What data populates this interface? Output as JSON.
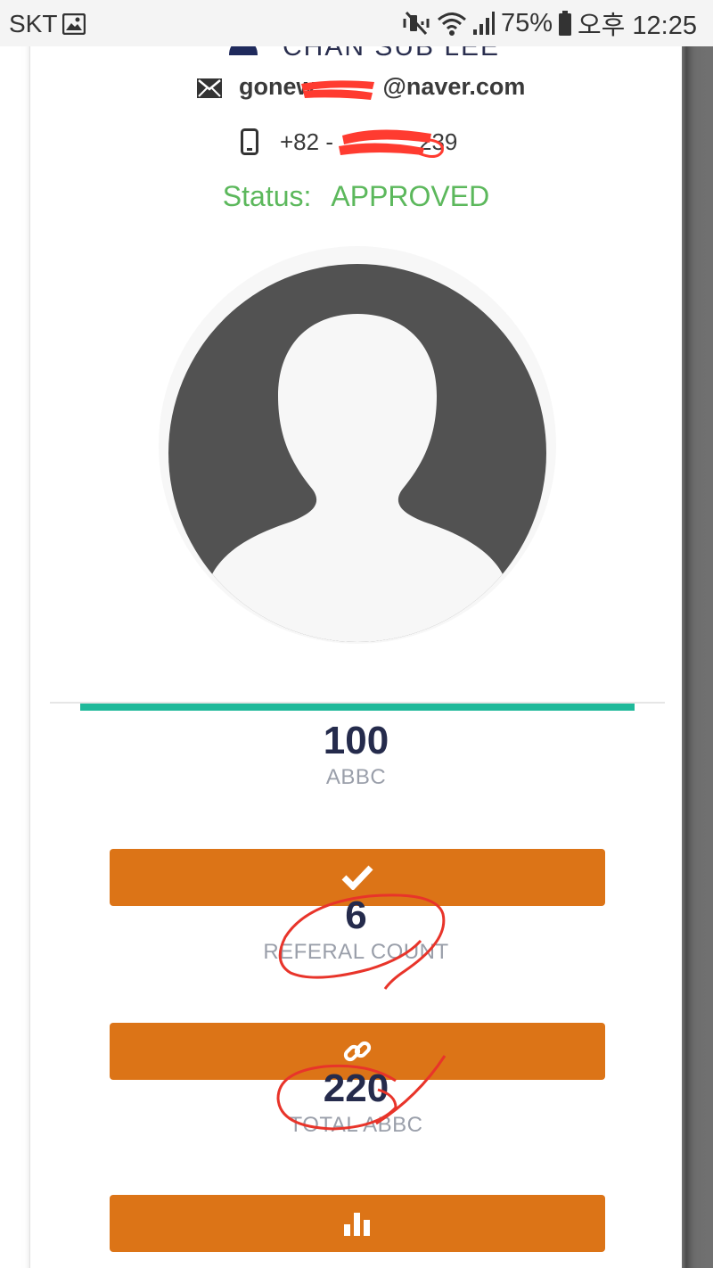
{
  "status_bar": {
    "carrier": "SKT",
    "battery": "75%",
    "time": "오후 12:25"
  },
  "profile": {
    "name": "CHAN SUB LEE",
    "email": "gonew      @naver.com",
    "email_prefix": "gonew",
    "email_suffix": "@naver.com",
    "phone_prefix": "+82 -",
    "phone_suffix": "239",
    "status_label": "Status:",
    "status_value": "APPROVED"
  },
  "progress": {
    "percent": 100
  },
  "stats": [
    {
      "value": "100",
      "label": "ABBC",
      "button_icon": "checkmark-icon"
    },
    {
      "value": "6",
      "label": "REFERAL COUNT",
      "button_icon": "link-icon"
    },
    {
      "value": "220",
      "label": "TOTAL ABBC",
      "button_icon": "bar-chart-icon"
    }
  ],
  "colors": {
    "status_green": "#5cb85c",
    "button_orange": "#dc7417",
    "progress_teal": "#1fb99a",
    "value_navy": "#252b4c",
    "avatar_gray": "#525252",
    "annotation_red": "#e8342a"
  }
}
